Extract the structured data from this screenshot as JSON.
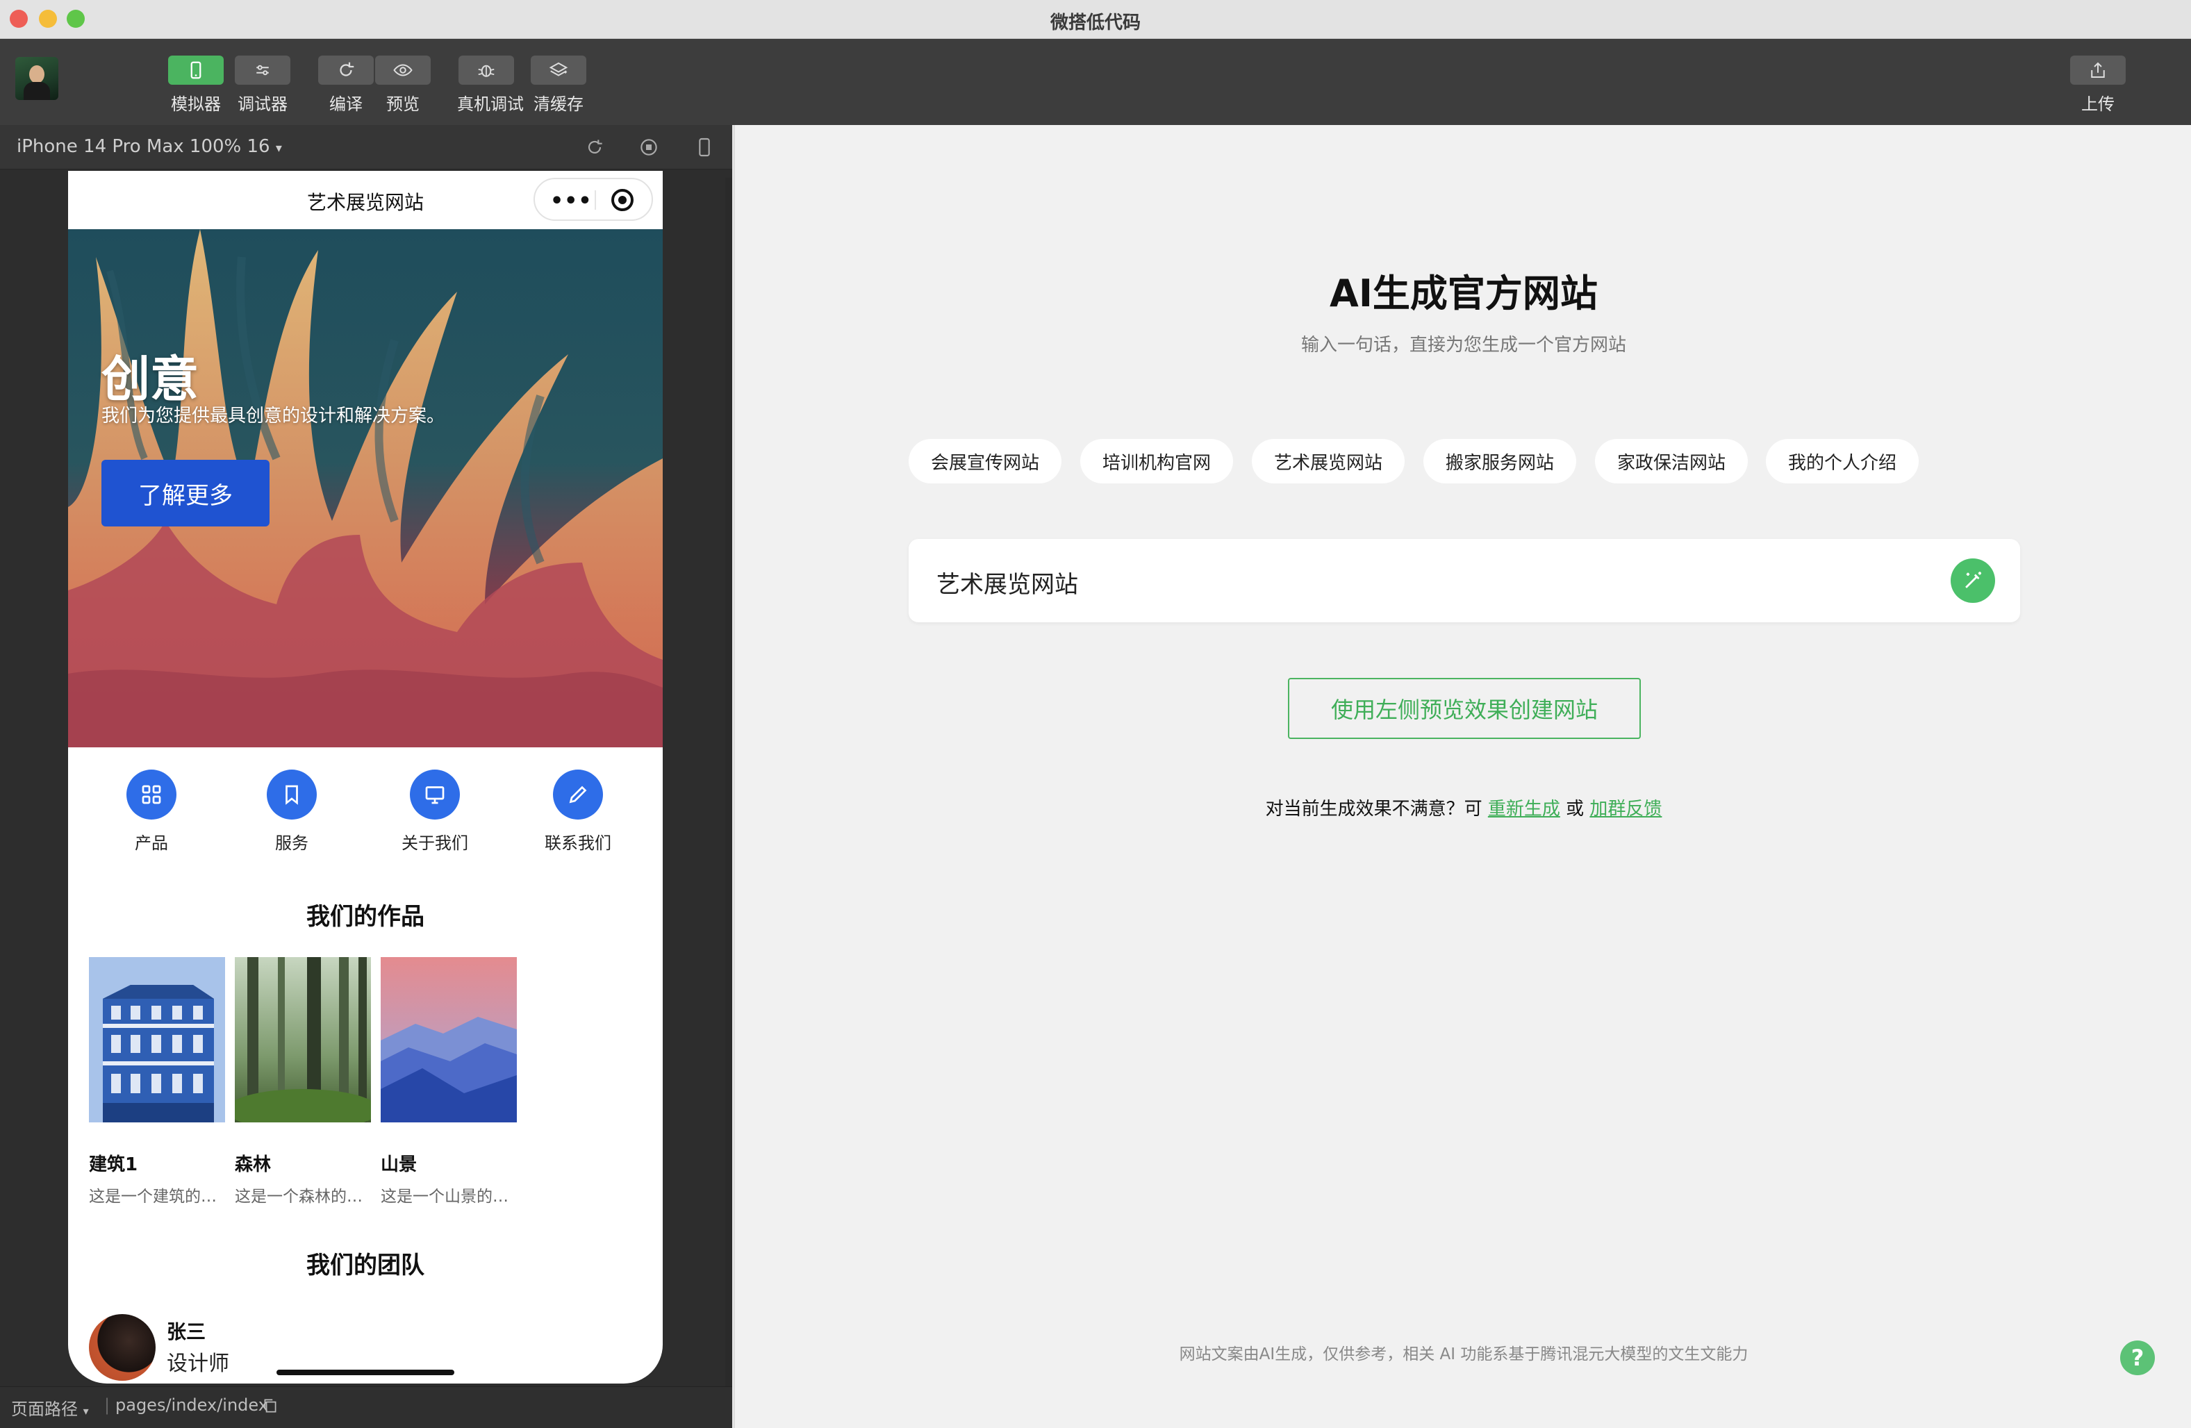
{
  "window": {
    "title": "微搭低代码"
  },
  "toolbar": {
    "buttons": [
      {
        "label": "模拟器",
        "icon": "phone-icon",
        "active": true
      },
      {
        "label": "调试器",
        "icon": "sliders-icon",
        "active": false
      },
      {
        "label": "编译",
        "icon": "refresh-icon",
        "active": false
      },
      {
        "label": "预览",
        "icon": "eye-icon",
        "active": false
      },
      {
        "label": "真机调试",
        "icon": "bug-icon",
        "active": false
      },
      {
        "label": "清缓存",
        "icon": "layers-icon",
        "active": false
      }
    ],
    "upload_label": "上传"
  },
  "simulator": {
    "device_label": "iPhone 14 Pro Max 100% 16",
    "status": {
      "path_label": "页面路径",
      "path_value": "pages/index/index"
    }
  },
  "miniprogram": {
    "nav_title": "艺术展览网站",
    "hero": {
      "title": "创意",
      "subtitle": "我们为您提供最具创意的设计和解决方案。",
      "button": "了解更多"
    },
    "quick_nav": [
      {
        "label": "产品",
        "icon": "grid-icon"
      },
      {
        "label": "服务",
        "icon": "bookmark-icon"
      },
      {
        "label": "关于我们",
        "icon": "monitor-icon"
      },
      {
        "label": "联系我们",
        "icon": "pencil-icon"
      }
    ],
    "works_title": "我们的作品",
    "works": [
      {
        "name": "建筑1",
        "desc": "这是一个建筑的…"
      },
      {
        "name": "森林",
        "desc": "这是一个森林的…"
      },
      {
        "name": "山景",
        "desc": "这是一个山景的…"
      }
    ],
    "team_title": "我们的团队",
    "team": [
      {
        "name": "张三",
        "role": "设计师"
      }
    ]
  },
  "main": {
    "title": "AI生成官方网站",
    "subtitle": "输入一句话，直接为您生成一个官方网站",
    "chips": [
      "会展宣传网站",
      "培训机构官网",
      "艺术展览网站",
      "搬家服务网站",
      "家政保洁网站",
      "我的个人介绍"
    ],
    "prompt_value": "艺术展览网站",
    "create_button": "使用左侧预览效果创建网站",
    "feedback": {
      "prefix": "对当前生成效果不满意？可",
      "regenerate": "重新生成",
      "or": "或",
      "group": "加群反馈"
    },
    "footer_note": "网站文案由AI生成，仅供参考，相关 AI 功能系基于腾讯混元大模型的文生文能力",
    "help": "?"
  },
  "colors": {
    "accent_green": "#4bb460",
    "primary_blue": "#1f53d1",
    "icon_blue": "#2e6de8"
  }
}
